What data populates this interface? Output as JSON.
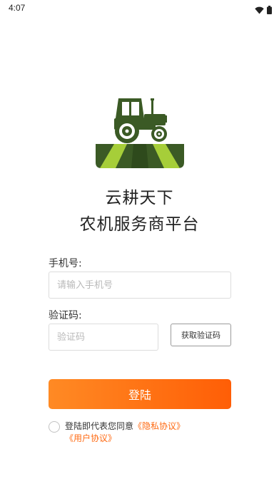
{
  "status_bar": {
    "time": "4:07",
    "icons": [
      "wifi-icon",
      "battery-icon"
    ]
  },
  "brand": {
    "logo_icon": "tractor-logo-icon",
    "title": "云耕天下",
    "subtitle": "农机服务商平台"
  },
  "form": {
    "phone_label": "手机号:",
    "phone_placeholder": "请输入手机号",
    "phone_value": "",
    "code_label": "验证码:",
    "code_placeholder": "验证码",
    "code_value": "",
    "get_code_label": "获取验证码",
    "login_label": "登陆"
  },
  "agreement": {
    "checked": false,
    "prefix": "登陆即代表您同意",
    "privacy_link": "《隐私协议》",
    "user_link": "《用户协议》"
  },
  "colors": {
    "accent": "#ff6a12",
    "button_gradient_start": "#ff8a24",
    "button_gradient_end": "#ff5e06",
    "tractor_green": "#3b5a25",
    "field_lime": "#a6ce39"
  }
}
